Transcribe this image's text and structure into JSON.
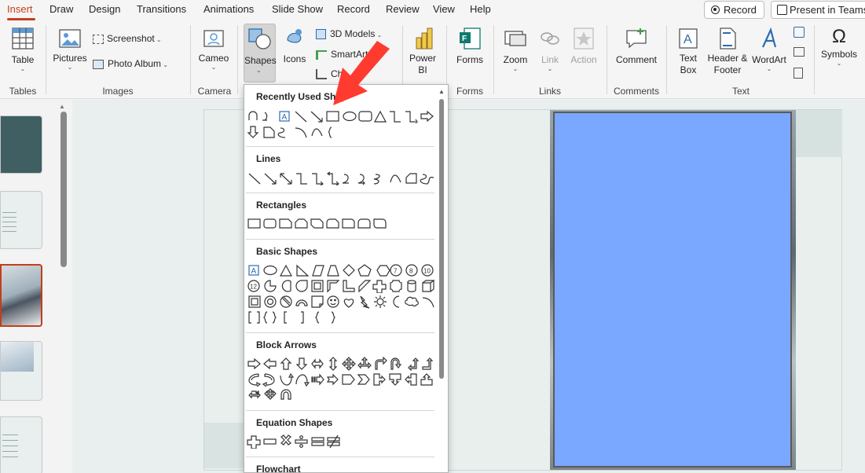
{
  "tabs": [
    "Insert",
    "Draw",
    "Design",
    "Transitions",
    "Animations",
    "Slide Show",
    "Record",
    "Review",
    "View",
    "Help"
  ],
  "active_tab": "Insert",
  "top_buttons": {
    "record": "Record",
    "present_in_teams": "Present in Teams"
  },
  "ribbon": {
    "table": "Table",
    "pictures": "Pictures",
    "screenshot": "Screenshot",
    "photo_album": "Photo Album",
    "cameo": "Cameo",
    "shapes": "Shapes",
    "icons": "Icons",
    "models_3d": "3D Models",
    "smartart": "SmartArt",
    "chart": "Ch",
    "power_bi": "Power BI",
    "forms": "Forms",
    "zoom": "Zoom",
    "link": "Link",
    "action": "Action",
    "comment": "Comment",
    "text_box": "Text Box",
    "header_footer": "Header & Footer",
    "wordart": "WordArt",
    "symbols": "Symbols"
  },
  "groups": [
    "Tables",
    "Images",
    "Camera",
    "Forms",
    "Links",
    "Comments",
    "Text"
  ],
  "shapes_menu": {
    "sections": [
      "Recently Used Shapes",
      "Lines",
      "Rectangles",
      "Basic Shapes",
      "Block Arrows",
      "Equation Shapes",
      "Flowchart"
    ],
    "recent_visible_title": "Recently Used Shap",
    "basic_shape_numbers": [
      "7",
      "8",
      "10",
      "12"
    ]
  },
  "colors": {
    "accent": "#c43e1c",
    "blue_shape": "#7aa7ff",
    "arrow": "#ff3b30"
  }
}
